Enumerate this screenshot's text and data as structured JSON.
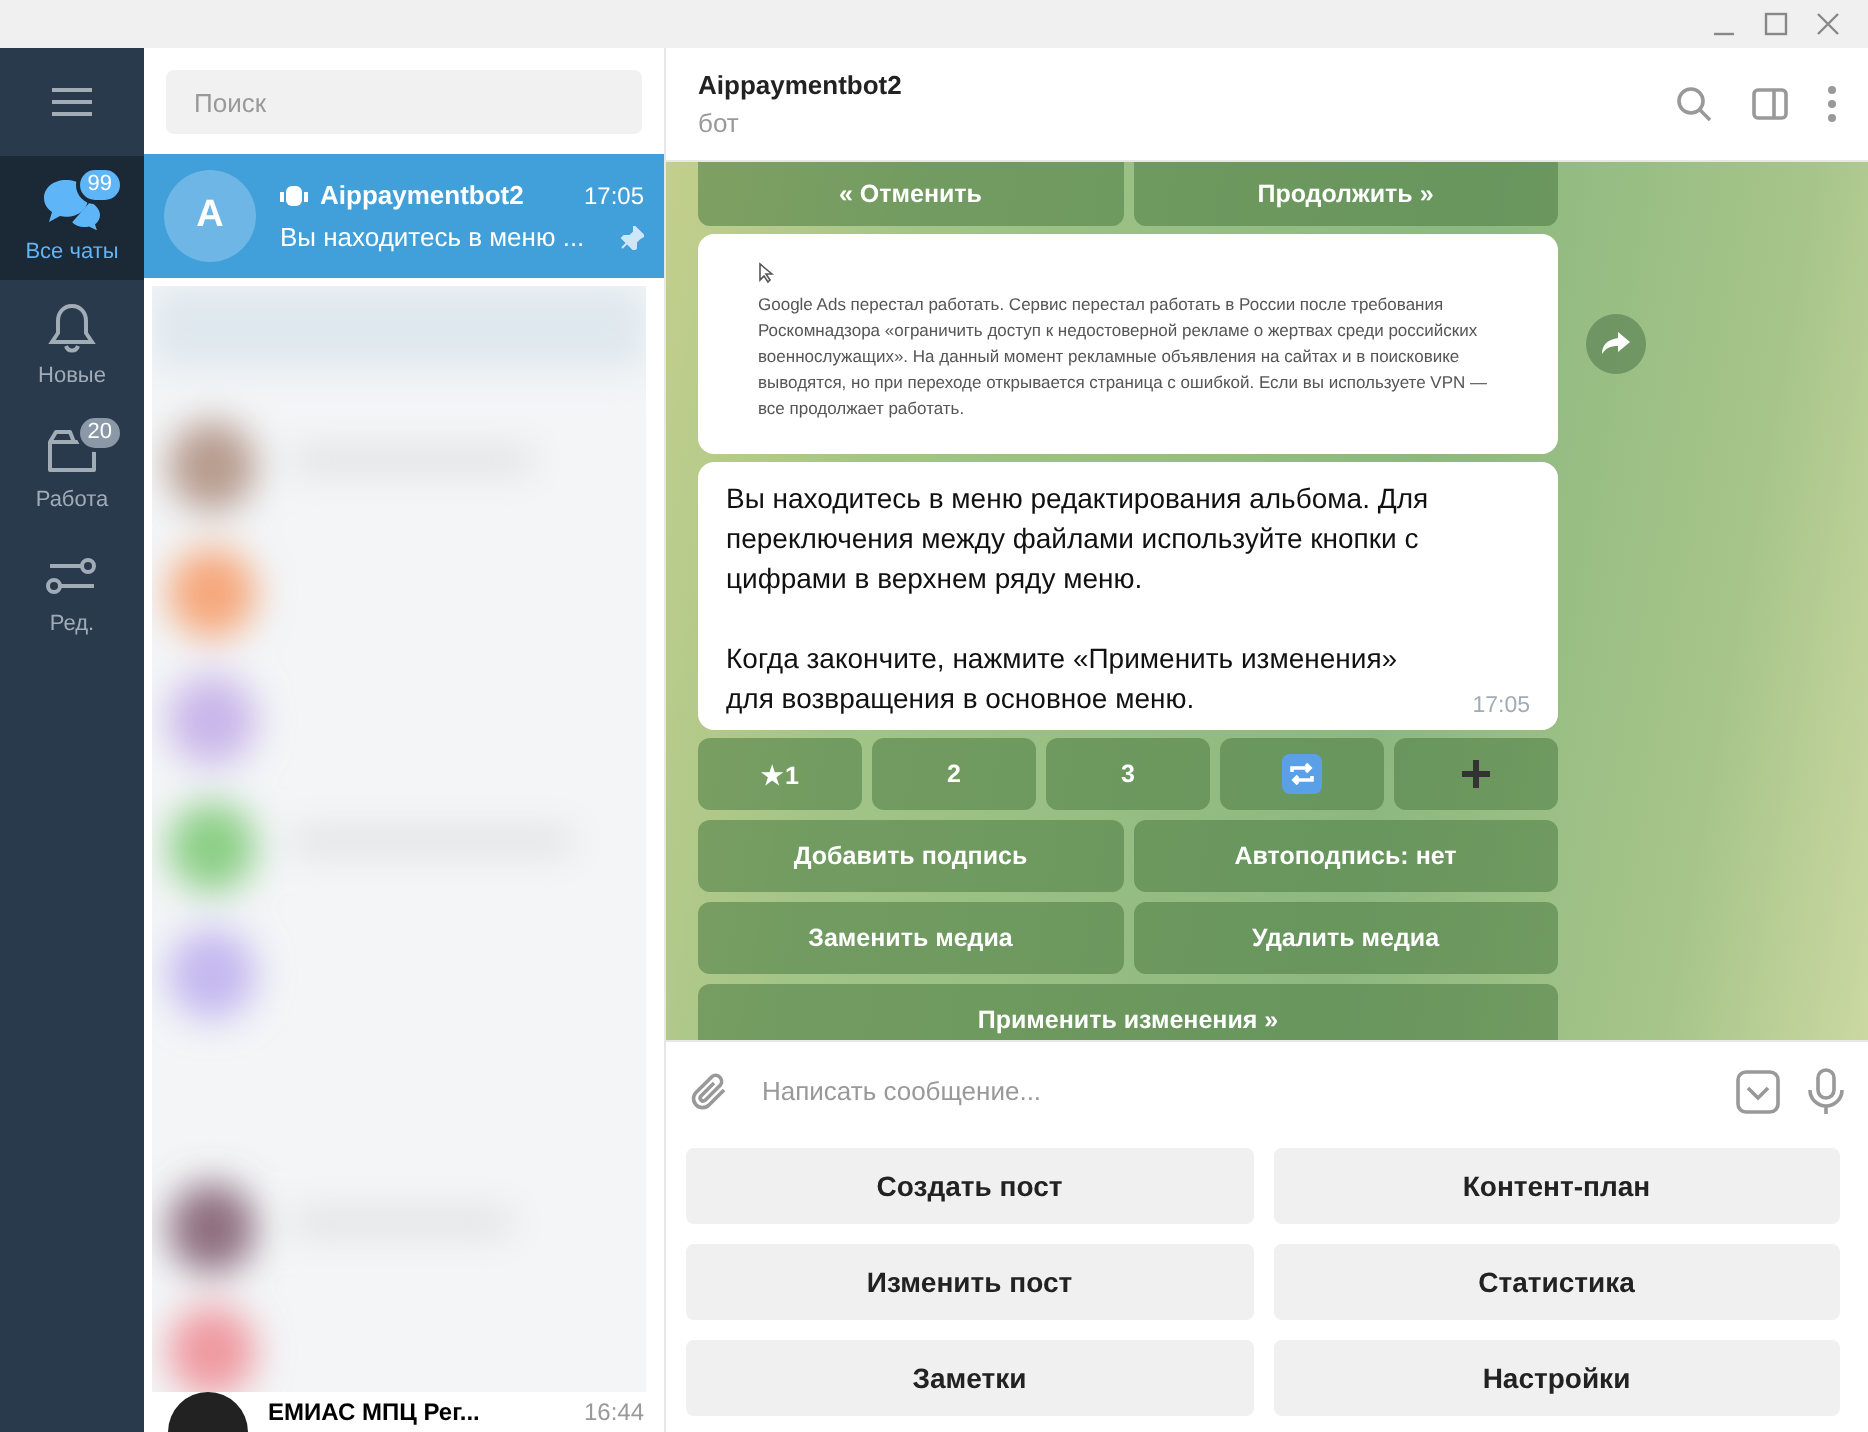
{
  "rail": {
    "items": [
      {
        "label": "Все чаты",
        "badge": "99",
        "selected": true
      },
      {
        "label": "Новые",
        "selected": false
      },
      {
        "label": "Работа",
        "badge": "20",
        "selected": false
      },
      {
        "label": "Ред.",
        "selected": false
      }
    ]
  },
  "search": {
    "placeholder": "Поиск"
  },
  "chats": [
    {
      "kind": "chat",
      "avatar": "A",
      "name": "Aippaymentbot2",
      "time": "17:05",
      "preview": "Вы находитесь в меню ...",
      "pinned": true,
      "selected": true
    },
    {
      "kind": "blurred"
    },
    {
      "kind": "chat",
      "name": "ЕМИАС МПЦ Рег...",
      "time": "16:44",
      "selected": false
    }
  ],
  "header": {
    "title": "Aippaymentbot2",
    "subtitle": "бот"
  },
  "top_buttons": [
    "« Отменить",
    "Продолжить »"
  ],
  "messages": [
    {
      "text": "Google Ads перестал работать. Сервис перестал работать в России после требования Роскомнадзора «ограничить доступ к недостоверной рекламе о жертвах среди российских военнослужащих». На данный момент рекламные объявления на сайтах и в поисковике выводятся, но при переходе открывается страница с ошибкой. Если вы используете VPN — все продолжает работать."
    },
    {
      "kind": "text",
      "paragraphs": [
        "Вы находитесь в меню редактирования альбома. Для переключения между файлами используйте кнопки с цифрами в верхнем ряду меню.",
        "Когда закончите, нажмите «Применить изменения» для возвращения в основное меню."
      ],
      "time": "17:05"
    }
  ],
  "inline_keyboard": [
    [
      {
        "label": "★1"
      },
      {
        "label": "2"
      },
      {
        "label": "3"
      },
      {
        "kind": "repeat"
      },
      {
        "kind": "plus"
      }
    ],
    [
      {
        "label": "Добавить подпись"
      },
      {
        "label": "Автоподпись: нет"
      }
    ],
    [
      {
        "label": "Заменить медиа"
      },
      {
        "label": "Удалить медиа"
      }
    ],
    [
      {
        "label": "Применить изменения »"
      }
    ]
  ],
  "composer": {
    "placeholder": "Написать сообщение..."
  },
  "reply_keyboard": [
    [
      "Создать пост",
      "Контент-план"
    ],
    [
      "Изменить пост",
      "Статистика"
    ],
    [
      "Заметки",
      "Настройки"
    ]
  ]
}
